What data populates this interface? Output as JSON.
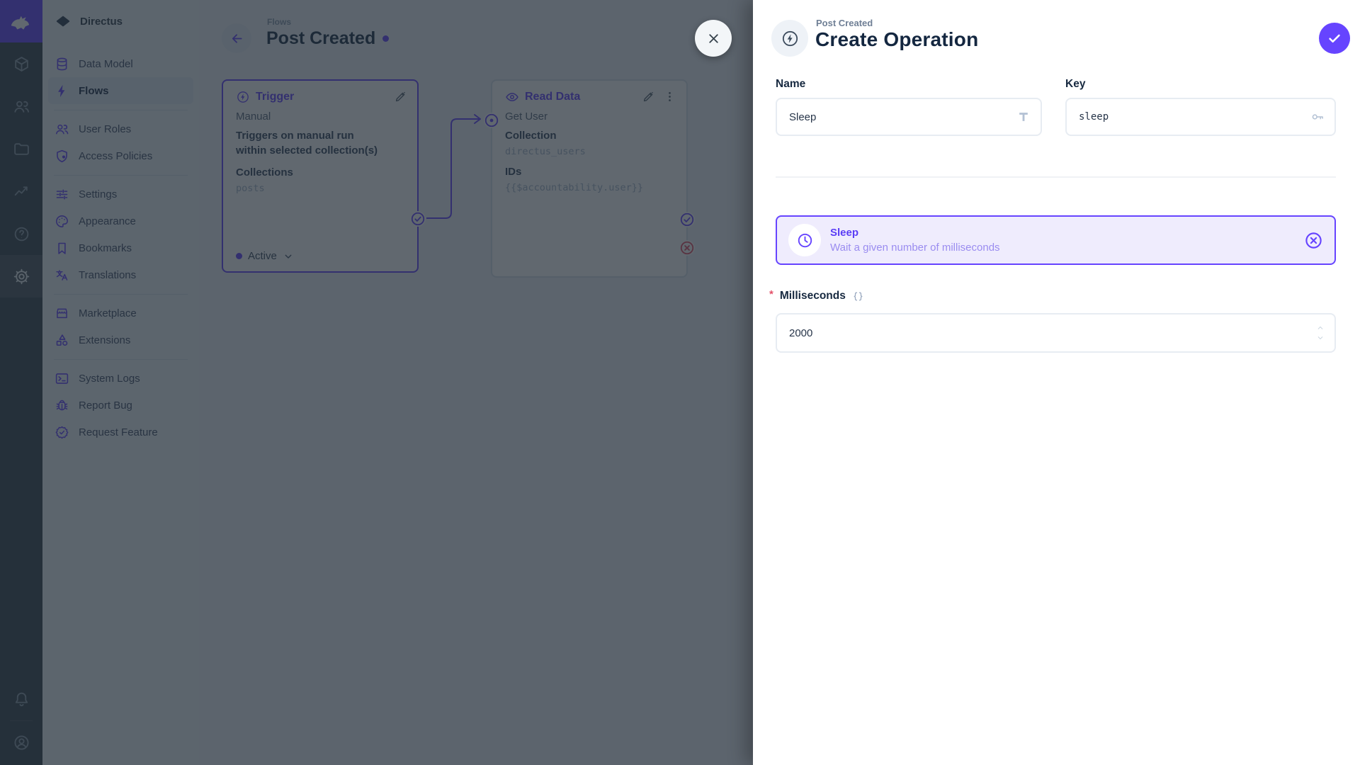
{
  "project": {
    "name": "Directus"
  },
  "module_bar": {
    "items": [
      {
        "id": "module-content",
        "icon": "box"
      },
      {
        "id": "module-users",
        "icon": "users"
      },
      {
        "id": "module-files",
        "icon": "folder"
      },
      {
        "id": "module-insights",
        "icon": "activity"
      },
      {
        "id": "module-docs",
        "icon": "help"
      },
      {
        "id": "module-settings",
        "icon": "gear",
        "active": true
      }
    ]
  },
  "sidebar": {
    "items": [
      {
        "id": "sidebar-item-data-model",
        "label": "Data Model",
        "icon": "database"
      },
      {
        "id": "sidebar-item-flows",
        "label": "Flows",
        "icon": "bolt",
        "active": true,
        "divider_after": true
      },
      {
        "id": "sidebar-item-user-roles",
        "label": "User Roles",
        "icon": "users"
      },
      {
        "id": "sidebar-item-access-policies",
        "label": "Access Policies",
        "icon": "shield",
        "divider_after": true
      },
      {
        "id": "sidebar-item-settings",
        "label": "Settings",
        "icon": "sliders"
      },
      {
        "id": "sidebar-item-appearance",
        "label": "Appearance",
        "icon": "palette"
      },
      {
        "id": "sidebar-item-bookmarks",
        "label": "Bookmarks",
        "icon": "bookmark"
      },
      {
        "id": "sidebar-item-translations",
        "label": "Translations",
        "icon": "translate",
        "divider_after": true
      },
      {
        "id": "sidebar-item-marketplace",
        "label": "Marketplace",
        "icon": "storefront"
      },
      {
        "id": "sidebar-item-extensions",
        "label": "Extensions",
        "icon": "shapes",
        "divider_after": true
      },
      {
        "id": "sidebar-item-system-logs",
        "label": "System Logs",
        "icon": "terminal"
      },
      {
        "id": "sidebar-item-report-bug",
        "label": "Report Bug",
        "icon": "bug"
      },
      {
        "id": "sidebar-item-request-feature",
        "label": "Request Feature",
        "icon": "badge-check"
      }
    ]
  },
  "canvas": {
    "breadcrumb": "Flows",
    "title": "Post Created",
    "trigger_panel": {
      "title": "Trigger",
      "type": "Manual",
      "description": "Triggers on manual run within selected collection(s)",
      "collections_label": "Collections",
      "collections_value": "posts",
      "status": "Active"
    },
    "read_panel": {
      "title": "Read Data",
      "name": "Get User",
      "collection_label": "Collection",
      "collection_value": "directus_users",
      "ids_label": "IDs",
      "ids_value": "{{$accountability.user}}"
    }
  },
  "drawer": {
    "breadcrumb": "Post Created",
    "title": "Create Operation",
    "name_field": {
      "label": "Name",
      "value": "Sleep"
    },
    "key_field": {
      "label": "Key",
      "value": "sleep"
    },
    "operation_card": {
      "title": "Sleep",
      "description": "Wait a given number of milliseconds"
    },
    "milliseconds_field": {
      "label": "Milliseconds",
      "value": "2000",
      "required_marker": "*"
    }
  },
  "colors": {
    "primary": "#6644ff",
    "danger": "#e35169",
    "heading": "#172940"
  }
}
